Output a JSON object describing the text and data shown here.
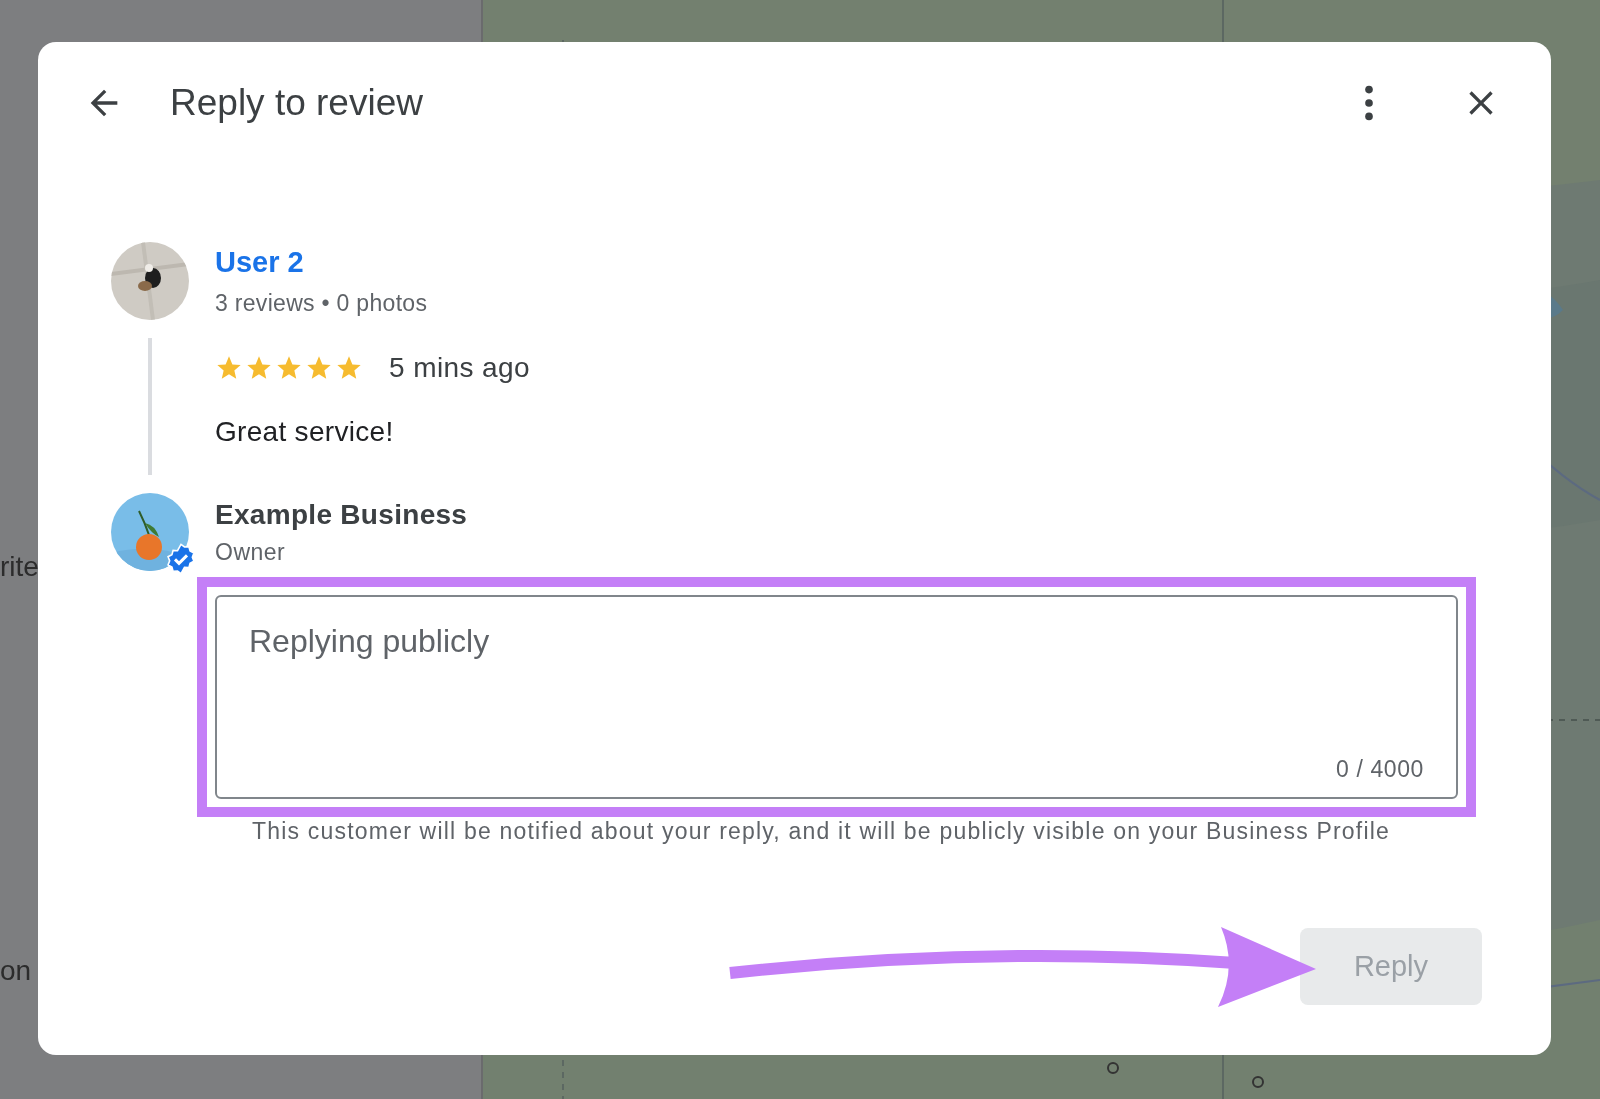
{
  "background": {
    "side_texts": [
      "rite",
      "on"
    ]
  },
  "dialog": {
    "title": "Reply to review",
    "review": {
      "author": "User 2",
      "meta": "3 reviews • 0 photos",
      "stars": 5,
      "time": "5 mins ago",
      "text": "Great service!"
    },
    "owner": {
      "name": "Example Business",
      "role": "Owner",
      "verified": true
    },
    "reply_field": {
      "placeholder": "Replying publicly",
      "counter": "0 / 4000",
      "highlighted": true
    },
    "notice": "This customer will be notified about your reply, and it will be publicly visible on your Business Profile",
    "reply_button": {
      "label": "Reply",
      "disabled": true,
      "pointed_at": true
    }
  }
}
